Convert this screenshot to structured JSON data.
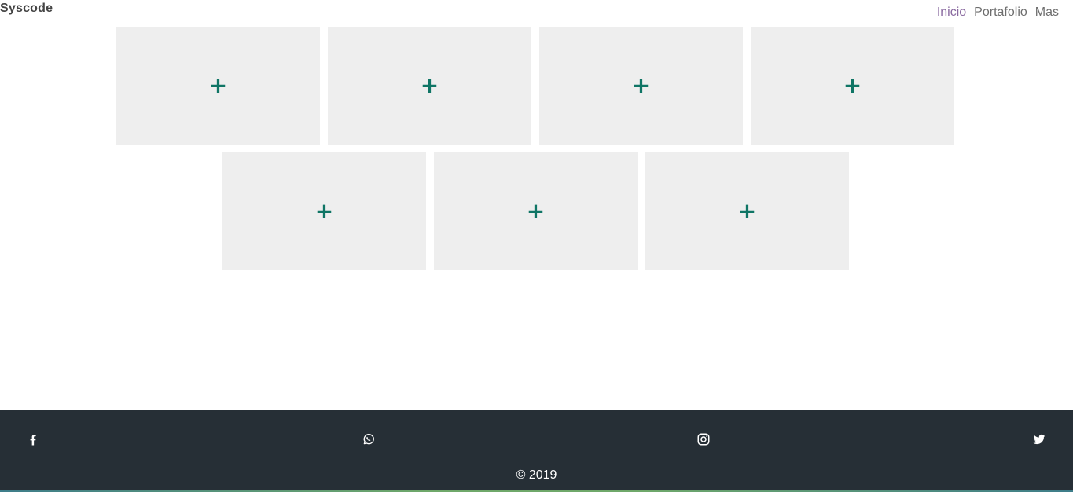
{
  "brand": {
    "name": "Syscode"
  },
  "nav": {
    "items": [
      {
        "label": "Inicio"
      },
      {
        "label": "Portafolio"
      },
      {
        "label": "Mas"
      }
    ]
  },
  "tiles": {
    "plus_symbol": "+"
  },
  "footer": {
    "social": [
      "facebook-icon",
      "whatsapp-icon",
      "instagram-icon",
      "twitter-icon"
    ],
    "copyright": "© 2019"
  },
  "colors": {
    "accent": "#0f7565",
    "tile_bg": "#eeeeee",
    "footer_bg": "#262f36"
  }
}
